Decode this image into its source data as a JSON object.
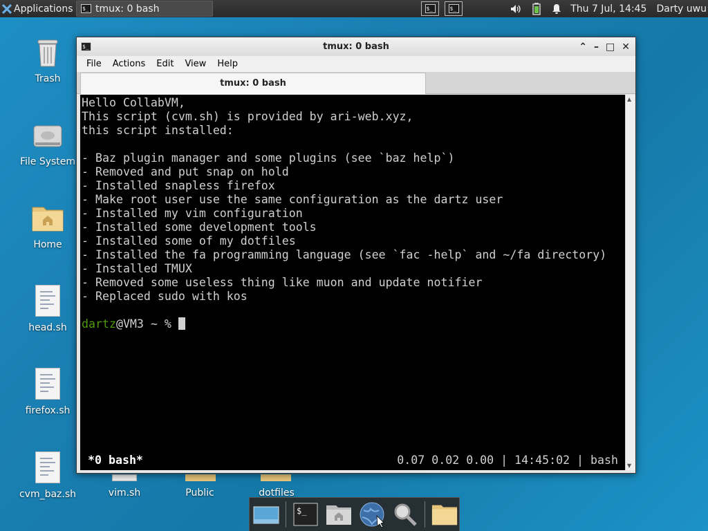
{
  "top_panel": {
    "apps_label": "Applications",
    "task_label": "tmux: 0 bash",
    "clock": "Thu  7 Jul, 14:45",
    "user": "Darty uwu"
  },
  "desktop": {
    "icons": [
      "Trash",
      "File System",
      "Home",
      "head.sh",
      "firefox.sh",
      "cvm_baz.sh",
      "vim.sh",
      "Public",
      "dotfiles"
    ]
  },
  "window": {
    "title": "tmux: 0 bash",
    "menu": [
      "File",
      "Actions",
      "Edit",
      "View",
      "Help"
    ],
    "tab_label": "tmux: 0 bash",
    "terminal_lines": [
      "Hello CollabVM,",
      "This script (cvm.sh) is provided by ari-web.xyz,",
      "this script installed:",
      "",
      "- Baz plugin manager and some plugins (see `baz help`)",
      "- Removed and put snap on hold",
      "- Installed snapless firefox",
      "- Make root user use the same configuration as the dartz user",
      "- Installed my vim configuration",
      "- Installed some development tools",
      "- Installed some of my dotfiles",
      "- Installed the fa programming language (see `fac -help` and ~/fa directory)",
      "- Installed TMUX",
      "- Removed some useless thing like muon and update notifier",
      "- Replaced sudo with kos",
      ""
    ],
    "prompt_user": "dartz",
    "prompt_rest": "@VM3 ~ % ",
    "status_left": "*0 bash*",
    "status_right": "0.07 0.02 0.00 | 14:45:02 | bash"
  },
  "colors": {
    "prompt_user": "#4e9a06",
    "desktop": "#1a7fb3"
  }
}
